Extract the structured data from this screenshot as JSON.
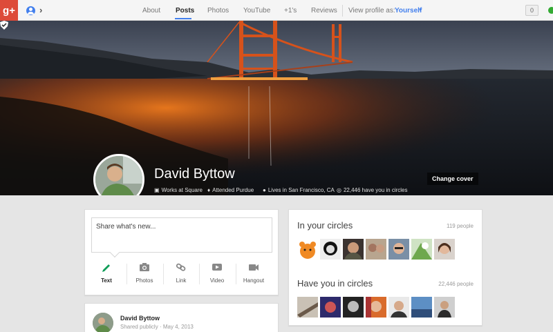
{
  "topbar": {
    "logo_text": "g+",
    "nav": [
      {
        "label": "About",
        "active": false
      },
      {
        "label": "Posts",
        "active": true
      },
      {
        "label": "Photos",
        "active": false
      },
      {
        "label": "YouTube",
        "active": false
      },
      {
        "label": "+1's",
        "active": false
      },
      {
        "label": "Reviews",
        "active": false
      }
    ],
    "view_profile_label": "View profile as:",
    "view_profile_value": "Yourself",
    "notification_count": "0"
  },
  "profile": {
    "name": "David Byttow",
    "verified": true,
    "facts": [
      {
        "icon": "briefcase-icon",
        "text": "Works at Square"
      },
      {
        "icon": "graduation-cap-icon",
        "text": "Attended Purdue"
      },
      {
        "icon": "location-pin-icon",
        "text": "Lives in San Francisco, CA"
      },
      {
        "icon": "circles-icon",
        "text": "22,446 have you in circles"
      }
    ],
    "change_cover_label": "Change cover"
  },
  "share_box": {
    "placeholder": "Share what's new...",
    "options": [
      {
        "label": "Text",
        "icon": "pencil-icon",
        "active": true
      },
      {
        "label": "Photos",
        "icon": "camera-icon",
        "active": false
      },
      {
        "label": "Link",
        "icon": "link-icon",
        "active": false
      },
      {
        "label": "Video",
        "icon": "video-icon",
        "active": false
      },
      {
        "label": "Hangout",
        "icon": "hangout-camera-icon",
        "active": false
      }
    ]
  },
  "post": {
    "author": "David Byttow",
    "visibility": "Shared publicly",
    "separator": "·",
    "date": "May 4, 2013"
  },
  "in_your_circles": {
    "title": "In your circles",
    "count": "119 people"
  },
  "have_you_in_circles": {
    "title": "Have you in circles",
    "count": "22,446 people"
  },
  "colors": {
    "brand": "#dd4b39",
    "accent": "#427fed",
    "active_share": "#0f9d58"
  }
}
